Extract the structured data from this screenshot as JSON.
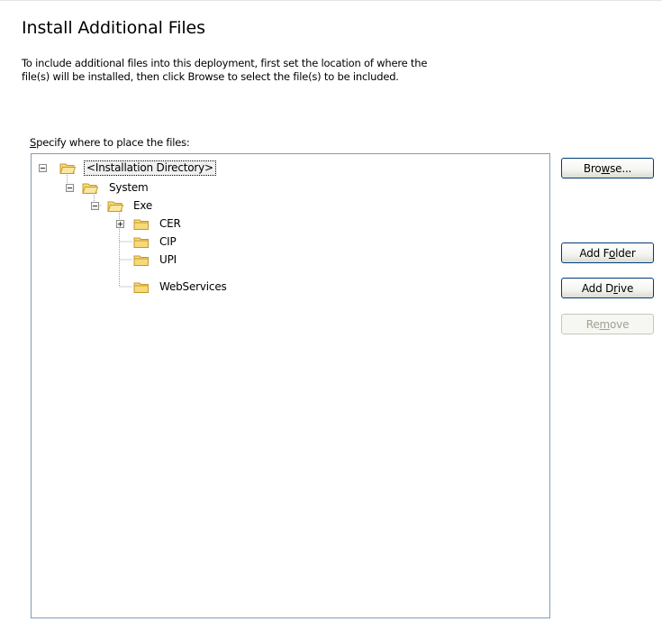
{
  "header": {
    "title": "Install Additional Files",
    "description_line1": "To include additional files into this deployment, first set the location of where the",
    "description_line2": "file(s) will be installed, then click Browse to select the file(s) to be included."
  },
  "tree": {
    "label_prefix": "S",
    "label_rest": "pecify where to place the files:",
    "nodes": [
      {
        "label": "<Installation Directory>",
        "expanded": true,
        "selected": true
      },
      {
        "label": "System",
        "expanded": true
      },
      {
        "label": "Exe",
        "expanded": true
      },
      {
        "label": "CER",
        "expanded": false
      },
      {
        "label": "CIP"
      },
      {
        "label": "UPI"
      },
      {
        "label": "WebServices"
      }
    ]
  },
  "buttons": {
    "browse": {
      "pre": "Bro",
      "key": "w",
      "post": "se..."
    },
    "add_folder": {
      "pre": "Add F",
      "key": "o",
      "post": "lder"
    },
    "add_drive": {
      "pre": "Add D",
      "key": "r",
      "post": "ive"
    },
    "remove": {
      "pre": "Re",
      "key": "m",
      "post": "ove",
      "enabled": false
    }
  },
  "colors": {
    "folder_fill": "#f7d97a",
    "folder_stroke": "#c59a2a",
    "tree_border": "#7f9db9",
    "button_border": "#003c74"
  }
}
